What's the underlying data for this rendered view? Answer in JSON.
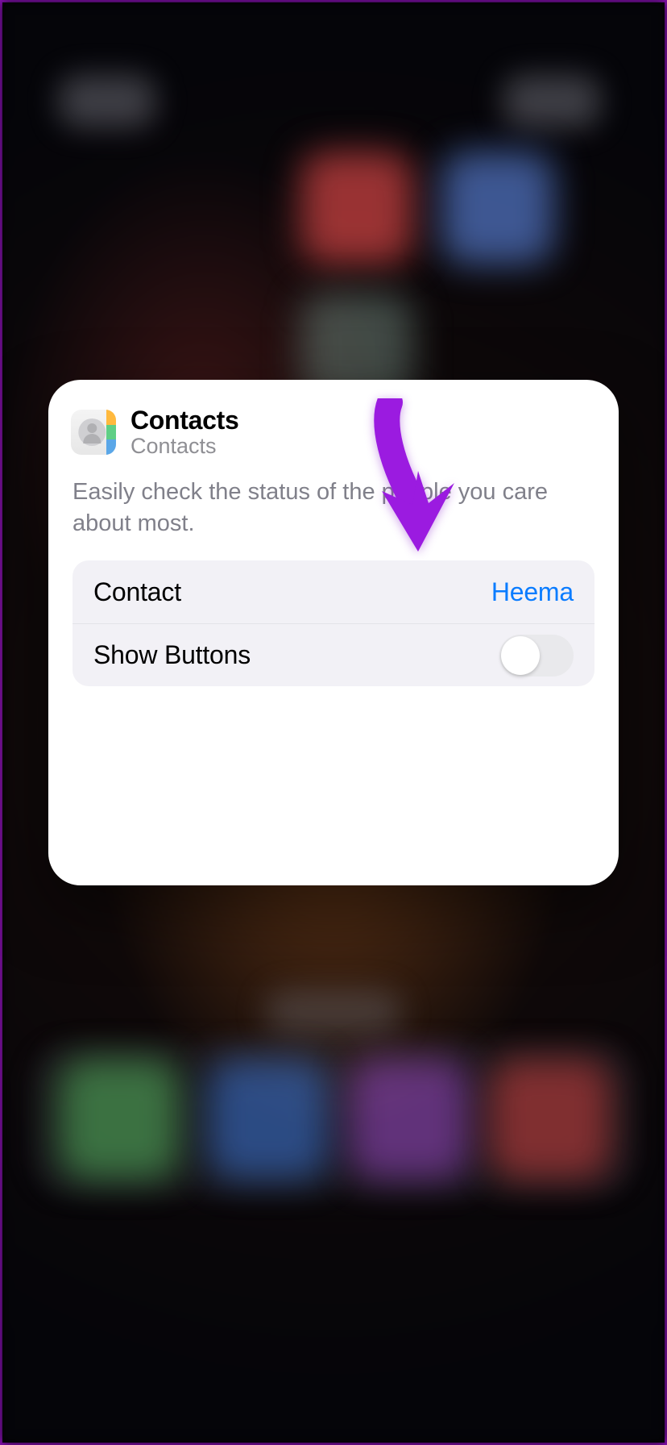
{
  "widget": {
    "title": "Contacts",
    "subtitle": "Contacts",
    "description": "Easily check the status of the people you care about most."
  },
  "rows": {
    "contact": {
      "label": "Contact",
      "value": "Heema"
    },
    "show_buttons": {
      "label": "Show Buttons",
      "enabled": false
    }
  },
  "annotation": {
    "arrow_color": "#9b1be0"
  }
}
